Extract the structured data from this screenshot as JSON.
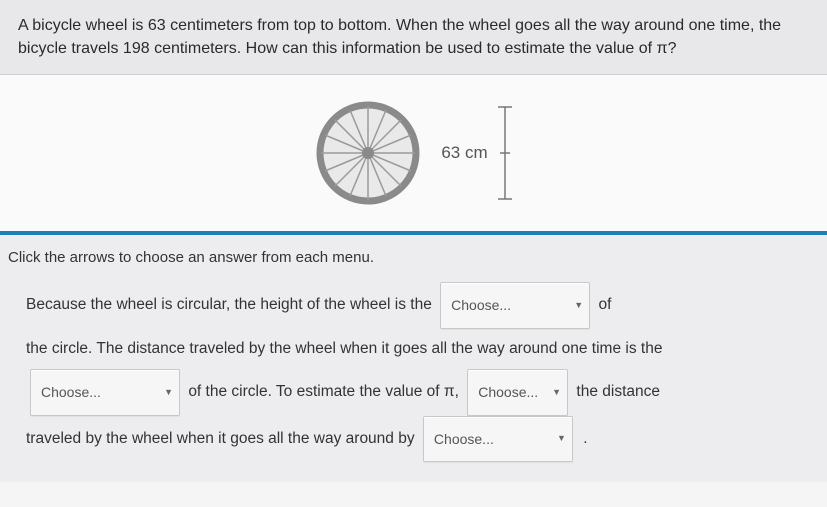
{
  "question": {
    "text": "A bicycle wheel is 63 centimeters from top to bottom. When the wheel goes all the way around one time, the bicycle travels 198 centimeters. How can this information be used to estimate the value of π?"
  },
  "diagram": {
    "measurement_label": "63 cm"
  },
  "instruction": "Click the arrows to choose an answer from each menu.",
  "sentence": {
    "p1": "Because the wheel is circular, the height of the wheel is the",
    "p2": "of",
    "p3": "the circle. The distance traveled by the wheel when it goes all the way around one time is the",
    "p4": "of the circle. To estimate the value of π,",
    "p5": "the distance",
    "p6": "traveled by the wheel when it goes all the way around by",
    "period": "."
  },
  "dropdown": {
    "placeholder": "Choose..."
  }
}
